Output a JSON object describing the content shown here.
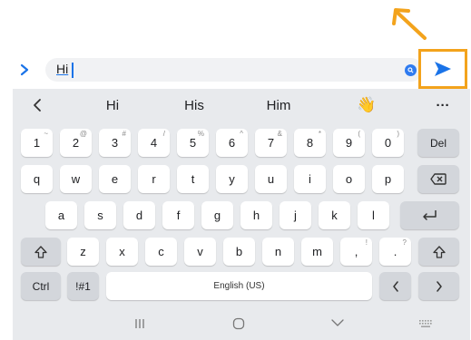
{
  "input": {
    "text": "Hi"
  },
  "suggestions": {
    "words": [
      "Hi",
      "His",
      "Him"
    ],
    "emoji": "👋",
    "more": "···"
  },
  "rows": {
    "numbers": [
      {
        "key": "1",
        "hint": "~"
      },
      {
        "key": "2",
        "hint": "@"
      },
      {
        "key": "3",
        "hint": "#"
      },
      {
        "key": "4",
        "hint": "/"
      },
      {
        "key": "5",
        "hint": "%"
      },
      {
        "key": "6",
        "hint": "^"
      },
      {
        "key": "7",
        "hint": "&"
      },
      {
        "key": "8",
        "hint": "*"
      },
      {
        "key": "9",
        "hint": "("
      },
      {
        "key": "0",
        "hint": ")"
      }
    ],
    "del_label": "Del",
    "row1": [
      "q",
      "w",
      "e",
      "r",
      "t",
      "y",
      "u",
      "i",
      "o",
      "p"
    ],
    "row2": [
      "a",
      "s",
      "d",
      "f",
      "g",
      "h",
      "j",
      "k",
      "l"
    ],
    "row3": [
      "z",
      "x",
      "c",
      "v",
      "b",
      "n",
      "m"
    ],
    "comma": ",",
    "comma_hint": "!",
    "period": ".",
    "period_hint": "?",
    "ctrl_label": "Ctrl",
    "symbols_label": "!#1",
    "space_label": "English (US)"
  },
  "colors": {
    "accent": "#1a73e8",
    "highlight": "#f3a31c",
    "keyboard_bg": "#e8eaed"
  }
}
